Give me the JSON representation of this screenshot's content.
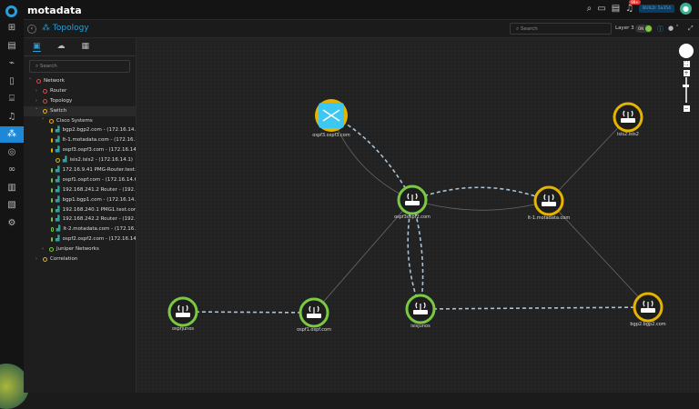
{
  "app": {
    "brand": "motadata",
    "build": "BUILD: 5a354",
    "notifications": "99+"
  },
  "rail": {
    "items": [
      "dashboard",
      "inventory",
      "metrics",
      "reports",
      "topology-alt",
      "alerts",
      "topology",
      "security",
      "binoculars",
      "logs",
      "tasks",
      "settings"
    ],
    "active": "topology"
  },
  "toolbar": {
    "title": "Topology",
    "search_placeholder": "Search",
    "layer_label": "Layer 3",
    "toggle_label": "ON"
  },
  "panel": {
    "search_placeholder": "Search",
    "tree": [
      {
        "label": "Network",
        "level": 0,
        "status": "#e04444",
        "expanded": true
      },
      {
        "label": "Router",
        "level": 1,
        "status": "#e04444"
      },
      {
        "label": "Topology",
        "level": 1,
        "status": "#e04444"
      },
      {
        "label": "Switch",
        "level": 1,
        "status": "#e5b400",
        "expanded": true,
        "selected": true
      },
      {
        "label": "Cisco Systems",
        "level": 2,
        "status": "#e5b400",
        "expanded": true
      },
      {
        "label": "bgp2.bgp2.com - (172.16.14.4)",
        "level": 3,
        "status": "#e5b400",
        "device": true
      },
      {
        "label": "lt-1.motadata.com - (172.16.1",
        "level": 3,
        "status": "#e5b400",
        "device": true
      },
      {
        "label": "ospf3.ospf3.com - (172.16.14.",
        "level": 3,
        "status": "#e5b400",
        "device": true
      },
      {
        "label": "isis2.isis2 - (172.16.14.1)",
        "level": 3,
        "status": "#e5b400",
        "device": true
      },
      {
        "label": "172.16.9.41 PMG-Router.test.c",
        "level": 3,
        "status": "#7ac943",
        "device": true
      },
      {
        "label": "ospf1.ospf.com - (172.16.14.6)",
        "level": 3,
        "status": "#7ac943",
        "device": true
      },
      {
        "label": "192.168.241.2 Router - (192.16",
        "level": 3,
        "status": "#7ac943",
        "device": true
      },
      {
        "label": "bgp1.bgp1.com - (172.16.14.2)",
        "level": 3,
        "status": "#7ac943",
        "device": true
      },
      {
        "label": "192.168.240.1 PMG1.test.com -",
        "level": 3,
        "status": "#7ac943",
        "device": true
      },
      {
        "label": "192.168.242.2 Router - (192.16",
        "level": 3,
        "status": "#7ac943",
        "device": true
      },
      {
        "label": "lt-2.motadata.com - (172.16.",
        "level": 3,
        "status": "#7ac943",
        "device": true
      },
      {
        "label": "ospf2.ospf2.com - (172.16.14.",
        "level": 3,
        "status": "#7ac943",
        "device": true
      },
      {
        "label": "Juniper Networks",
        "level": 2,
        "status": "#7ac943"
      },
      {
        "label": "Correlation",
        "level": 1,
        "status": "#e5b400"
      }
    ]
  },
  "topology": {
    "nodes": [
      {
        "id": "ospf3",
        "label": "ospf3.ospf3.com",
        "type": "switch",
        "status": "#e5b400"
      },
      {
        "id": "ospf2",
        "label": "ospf3ospf2.com",
        "type": "router",
        "status": "#7ac943"
      },
      {
        "id": "lt1",
        "label": "lt-1.motadata.com",
        "type": "router",
        "status": "#e5b400"
      },
      {
        "id": "isis2",
        "label": "isis2.isis2",
        "type": "router",
        "status": "#e5b400"
      },
      {
        "id": "ospfjunos",
        "label": "ospfjunos",
        "type": "router",
        "status": "#7ac943"
      },
      {
        "id": "ospf1",
        "label": "ospf1.ospf.com",
        "type": "router",
        "status": "#7ac943"
      },
      {
        "id": "isisjunos",
        "label": "isisjunos",
        "type": "router",
        "status": "#7ac943"
      },
      {
        "id": "bgp2",
        "label": "bgp2.bgp2.com",
        "type": "router",
        "status": "#e5b400"
      }
    ],
    "links": [
      {
        "from": "ospf3",
        "to": "ospf2",
        "style": "dashed"
      },
      {
        "from": "ospf3",
        "to": "ospf2",
        "style": "solid"
      },
      {
        "from": "ospf2",
        "to": "lt1",
        "style": "dashed"
      },
      {
        "from": "ospf2",
        "to": "lt1",
        "style": "solid"
      },
      {
        "from": "lt1",
        "to": "isis2",
        "style": "solid"
      },
      {
        "from": "lt1",
        "to": "bgp2",
        "style": "solid"
      },
      {
        "from": "ospf2",
        "to": "ospf1",
        "style": "solid"
      },
      {
        "from": "ospf2",
        "to": "isisjunos",
        "style": "dashed"
      },
      {
        "from": "ospf2",
        "to": "isisjunos",
        "style": "dashed"
      },
      {
        "from": "ospfjunos",
        "to": "ospf1",
        "style": "dashed"
      },
      {
        "from": "isisjunos",
        "to": "bgp2",
        "style": "dashed"
      }
    ]
  }
}
